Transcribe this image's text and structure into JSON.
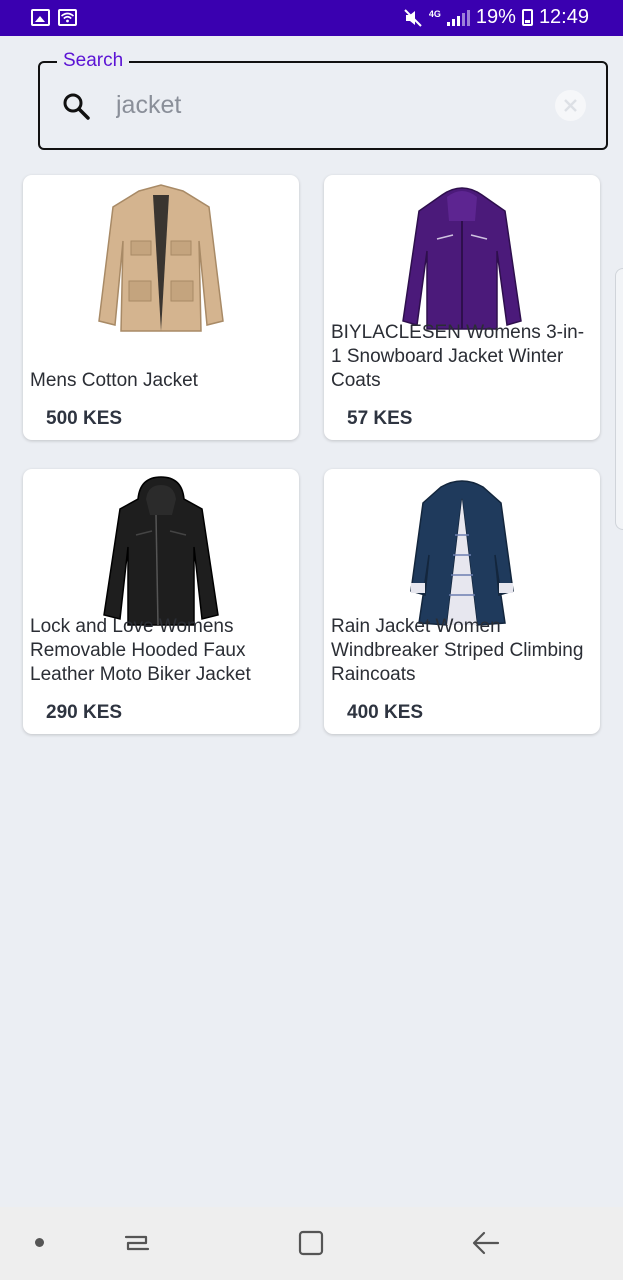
{
  "status_bar": {
    "network": "4G",
    "battery": "19%",
    "time": "12:49",
    "bg_color": "#3a00b0"
  },
  "search": {
    "legend": "Search",
    "value": "jacket",
    "accent_color": "#5b13d4"
  },
  "products": [
    {
      "title": "Mens Cotton Jacket",
      "price": "500 KES",
      "image": "beige-cotton-jacket"
    },
    {
      "title": "BIYLACLESEN Womens 3-in-1 Snowboard Jacket Winter Coats",
      "price": "57 KES",
      "image": "purple-snowboard-jacket"
    },
    {
      "title": "Lock and Love Womens Removable Hooded Faux Leather Moto Biker Jacket",
      "price": "290 KES",
      "image": "black-leather-hooded-jacket"
    },
    {
      "title": "Rain Jacket Women Windbreaker Striped Climbing Raincoats",
      "price": "400 KES",
      "image": "navy-rain-jacket"
    }
  ],
  "nav_icons": [
    "dot-icon",
    "recent-apps-icon",
    "home-icon",
    "back-icon"
  ]
}
